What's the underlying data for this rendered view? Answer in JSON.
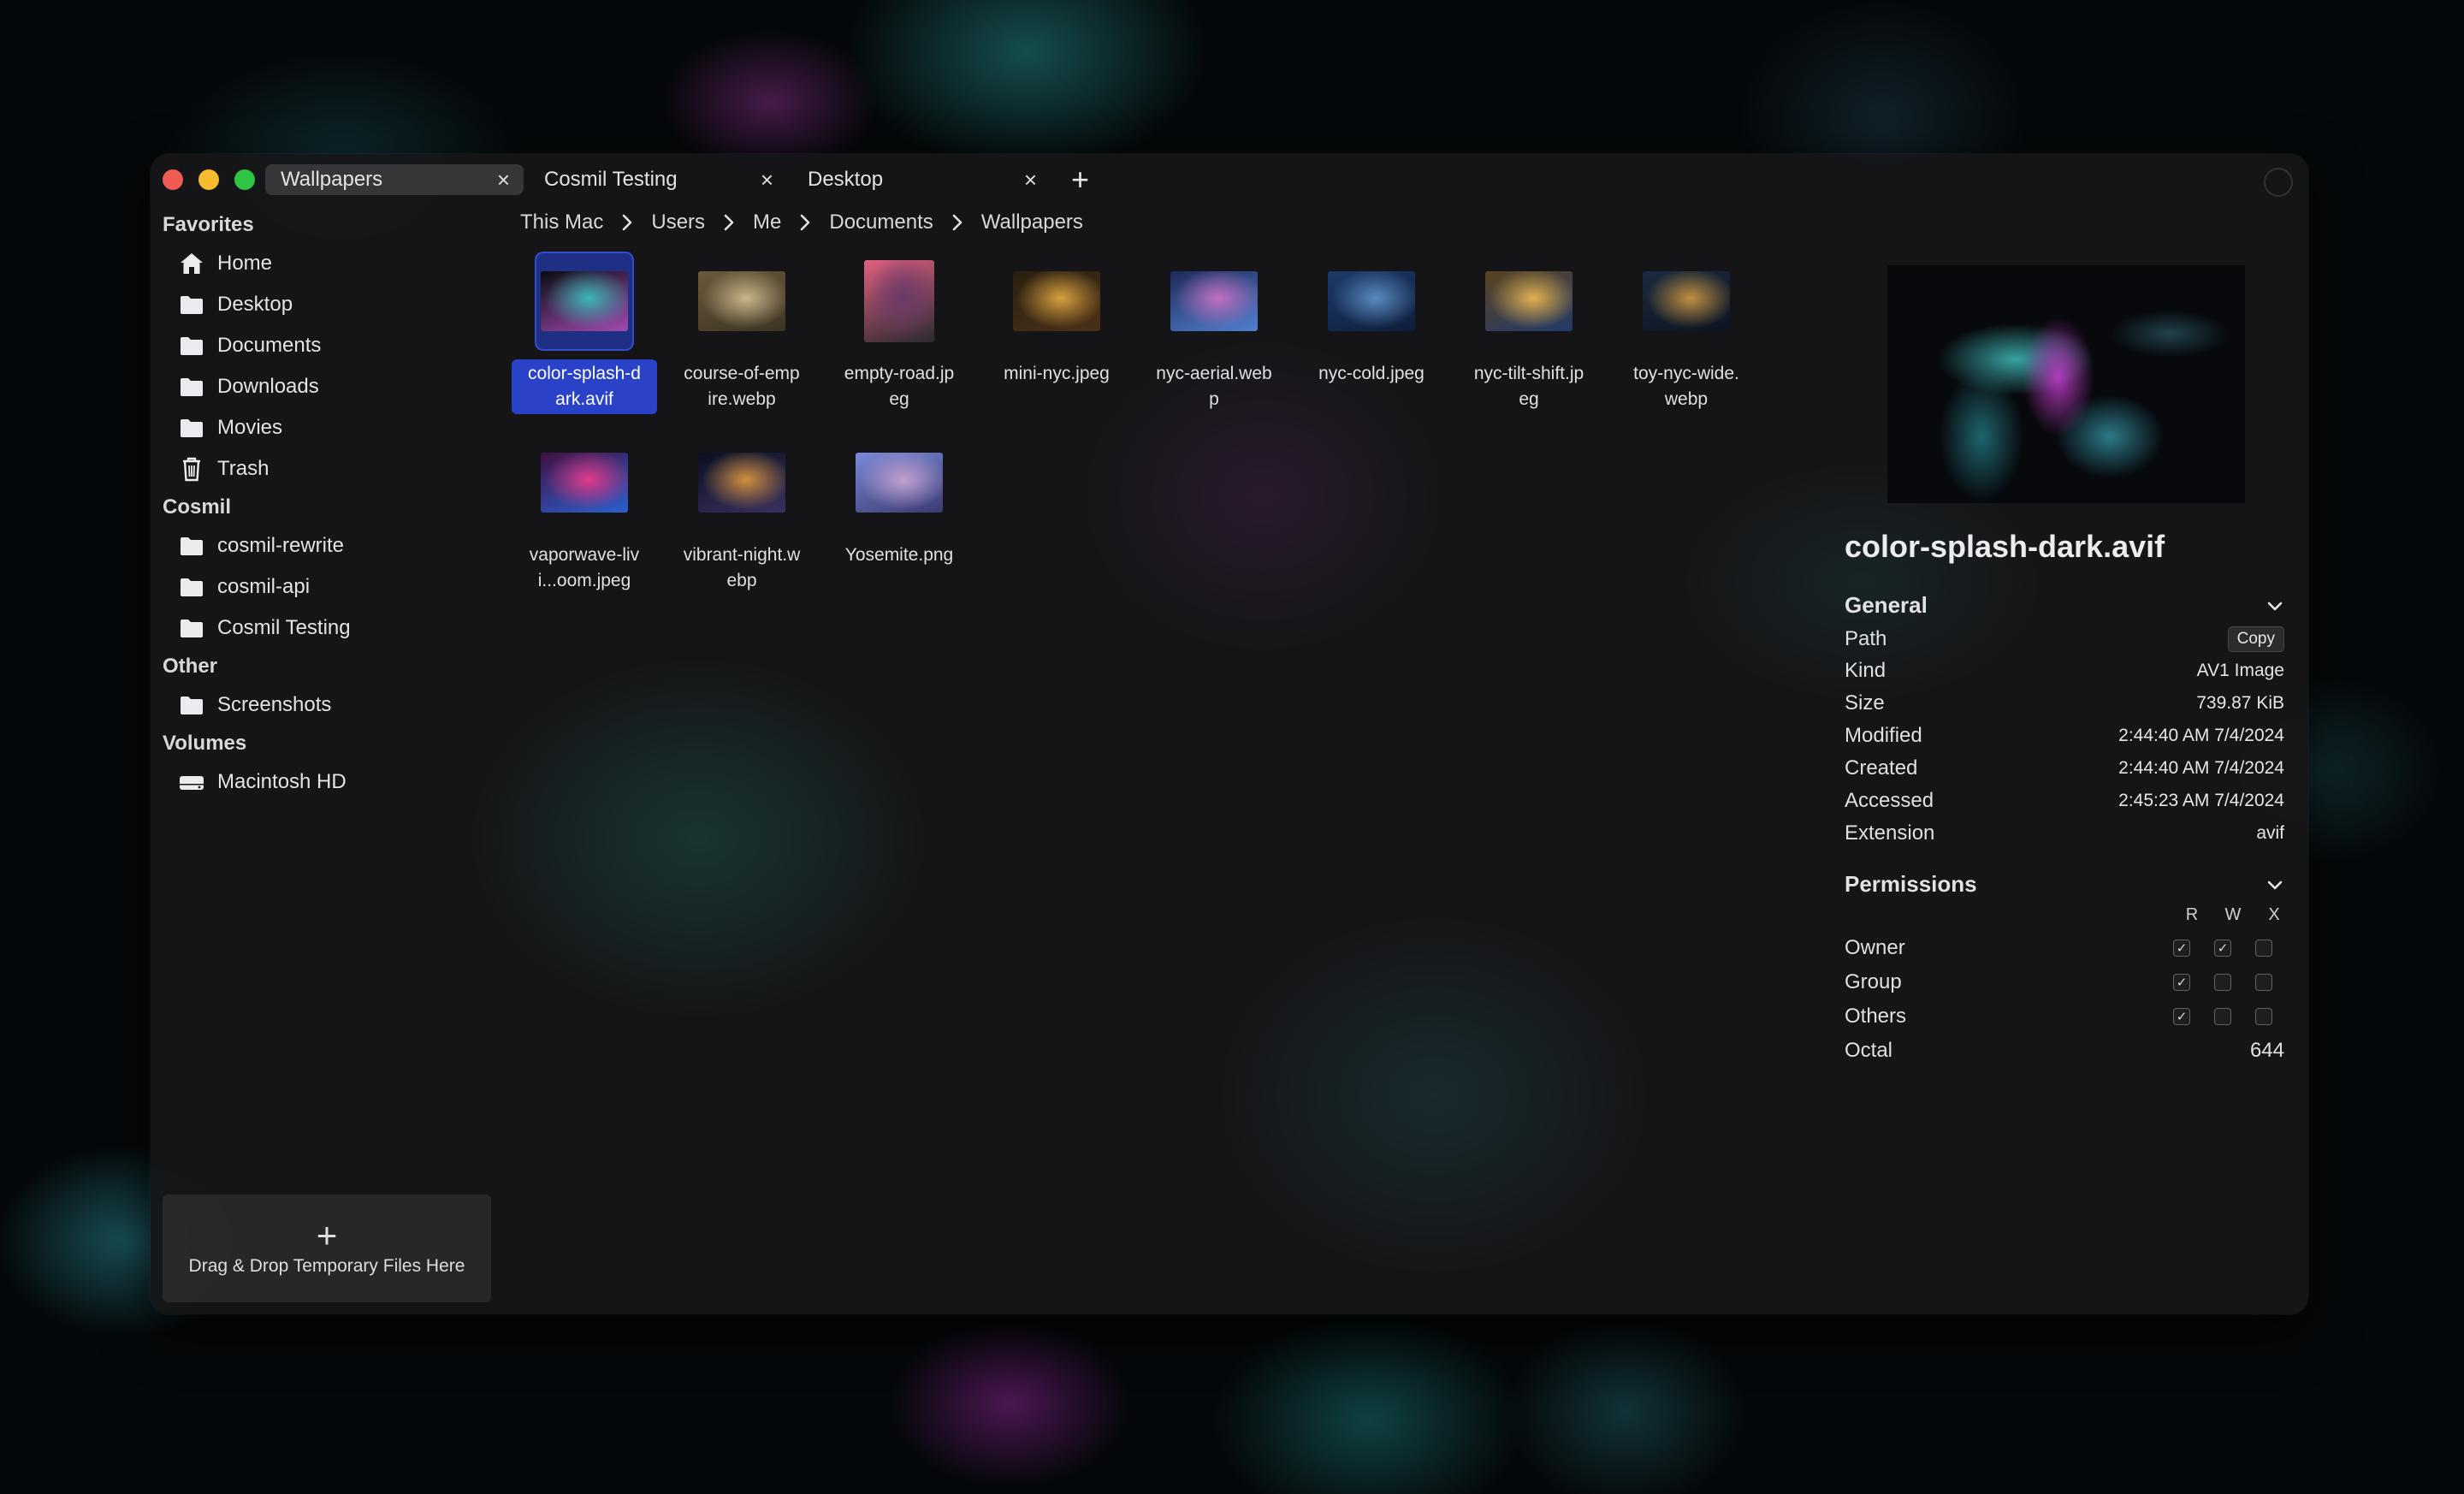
{
  "tabs": [
    {
      "label": "Wallpapers",
      "active": true
    },
    {
      "label": "Cosmil Testing",
      "active": false
    },
    {
      "label": "Desktop",
      "active": false
    }
  ],
  "sidebar": {
    "sections": [
      {
        "title": "Favorites",
        "items": [
          {
            "label": "Home",
            "icon": "home-icon"
          },
          {
            "label": "Desktop",
            "icon": "folder-icon"
          },
          {
            "label": "Documents",
            "icon": "folder-icon"
          },
          {
            "label": "Downloads",
            "icon": "folder-icon"
          },
          {
            "label": "Movies",
            "icon": "folder-icon"
          },
          {
            "label": "Trash",
            "icon": "trash-icon"
          }
        ]
      },
      {
        "title": "Cosmil",
        "items": [
          {
            "label": "cosmil-rewrite",
            "icon": "folder-icon"
          },
          {
            "label": "cosmil-api",
            "icon": "folder-icon"
          },
          {
            "label": "Cosmil Testing",
            "icon": "folder-icon"
          }
        ]
      },
      {
        "title": "Other",
        "items": [
          {
            "label": "Screenshots",
            "icon": "folder-icon"
          }
        ]
      },
      {
        "title": "Volumes",
        "items": [
          {
            "label": "Macintosh HD",
            "icon": "drive-icon"
          }
        ]
      }
    ]
  },
  "dropzone": {
    "label": "Drag & Drop Temporary Files Here"
  },
  "breadcrumb": [
    "This Mac",
    "Users",
    "Me",
    "Documents",
    "Wallpapers"
  ],
  "files": [
    {
      "name": "color-splash-d\nark.avif",
      "selected": true,
      "colors": [
        "#0a0c12",
        "#3fb6b8",
        "#a24ab0"
      ]
    },
    {
      "name": "course-of-emp\nire.webp",
      "selected": false,
      "colors": [
        "#6b5a3a",
        "#c9b58a",
        "#3b3323"
      ]
    },
    {
      "name": "empty-road.jp\neg",
      "selected": false,
      "colors": [
        "#e06080",
        "#6a3a6a",
        "#2a2a30"
      ],
      "tall": true
    },
    {
      "name": "mini-nyc.jpeg",
      "selected": false,
      "colors": [
        "#2a2010",
        "#d6a040",
        "#4a3018"
      ]
    },
    {
      "name": "nyc-aerial.web\np",
      "selected": false,
      "colors": [
        "#1e2a5a",
        "#c070c0",
        "#5080d0"
      ]
    },
    {
      "name": "nyc-cold.jpeg",
      "selected": false,
      "colors": [
        "#1c3a6a",
        "#5a8ac0",
        "#0e1e3a"
      ]
    },
    {
      "name": "nyc-tilt-shift.jp\neg",
      "selected": false,
      "colors": [
        "#5a4420",
        "#e0b050",
        "#223a6a"
      ]
    },
    {
      "name": "toy-nyc-wide.\nwebp",
      "selected": false,
      "colors": [
        "#1a2a40",
        "#c09040",
        "#0e1420"
      ]
    },
    {
      "name": "vaporwave-liv\ni...oom.jpeg",
      "selected": false,
      "colors": [
        "#401040",
        "#e03a8a",
        "#2a60d0"
      ]
    },
    {
      "name": "vibrant-night.w\nebp",
      "selected": false,
      "colors": [
        "#0a1020",
        "#d09040",
        "#3a3060"
      ]
    },
    {
      "name": "Yosemite.png",
      "selected": false,
      "colors": [
        "#7a8ad8",
        "#c0a0d0",
        "#3a3a70"
      ]
    }
  ],
  "inspector": {
    "title": "color-splash-dark.avif",
    "general_label": "General",
    "rows": [
      {
        "label": "Path",
        "value": "Copy",
        "is_button": true
      },
      {
        "label": "Kind",
        "value": "AV1 Image"
      },
      {
        "label": "Size",
        "value": "739.87 KiB"
      },
      {
        "label": "Modified",
        "value": "2:44:40 AM 7/4/2024"
      },
      {
        "label": "Created",
        "value": "2:44:40 AM 7/4/2024"
      },
      {
        "label": "Accessed",
        "value": "2:45:23 AM 7/4/2024"
      },
      {
        "label": "Extension",
        "value": "avif"
      }
    ],
    "permissions_label": "Permissions",
    "perm_headers": [
      "R",
      "W",
      "X"
    ],
    "perm_rows": [
      {
        "label": "Owner",
        "checks": [
          true,
          true,
          false
        ]
      },
      {
        "label": "Group",
        "checks": [
          true,
          false,
          false
        ]
      },
      {
        "label": "Others",
        "checks": [
          true,
          false,
          false
        ]
      }
    ],
    "octal_label": "Octal",
    "octal_value": "644"
  }
}
